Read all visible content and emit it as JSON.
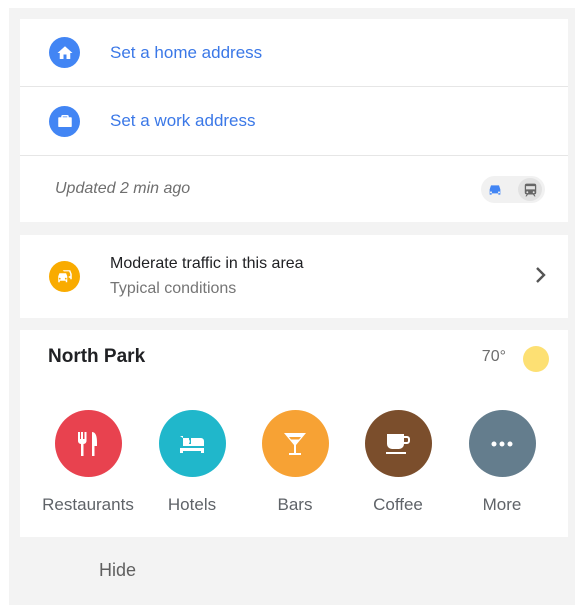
{
  "addresses": {
    "home_label": "Set a home address",
    "work_label": "Set a work address"
  },
  "status": {
    "updated": "Updated 2 min ago",
    "mode_selected": "driving"
  },
  "traffic": {
    "title": "Moderate traffic in this area",
    "subtitle": "Typical conditions"
  },
  "area": {
    "name": "North Park",
    "temperature": "70°"
  },
  "categories": [
    {
      "label": "Restaurants",
      "icon": "fork-knife-icon",
      "color": "#e8424f"
    },
    {
      "label": "Hotels",
      "icon": "bed-icon",
      "color": "#20b7cb"
    },
    {
      "label": "Bars",
      "icon": "cocktail-icon",
      "color": "#f7a234"
    },
    {
      "label": "Coffee",
      "icon": "coffee-cup-icon",
      "color": "#7b4e2c"
    },
    {
      "label": "More",
      "icon": "more-dots-icon",
      "color": "#647d8d"
    }
  ],
  "footer": {
    "hide_label": "Hide"
  },
  "colors": {
    "accent_blue": "#4285f4",
    "link_blue": "#3b78e7",
    "traffic_yellow": "#f9ab00"
  }
}
